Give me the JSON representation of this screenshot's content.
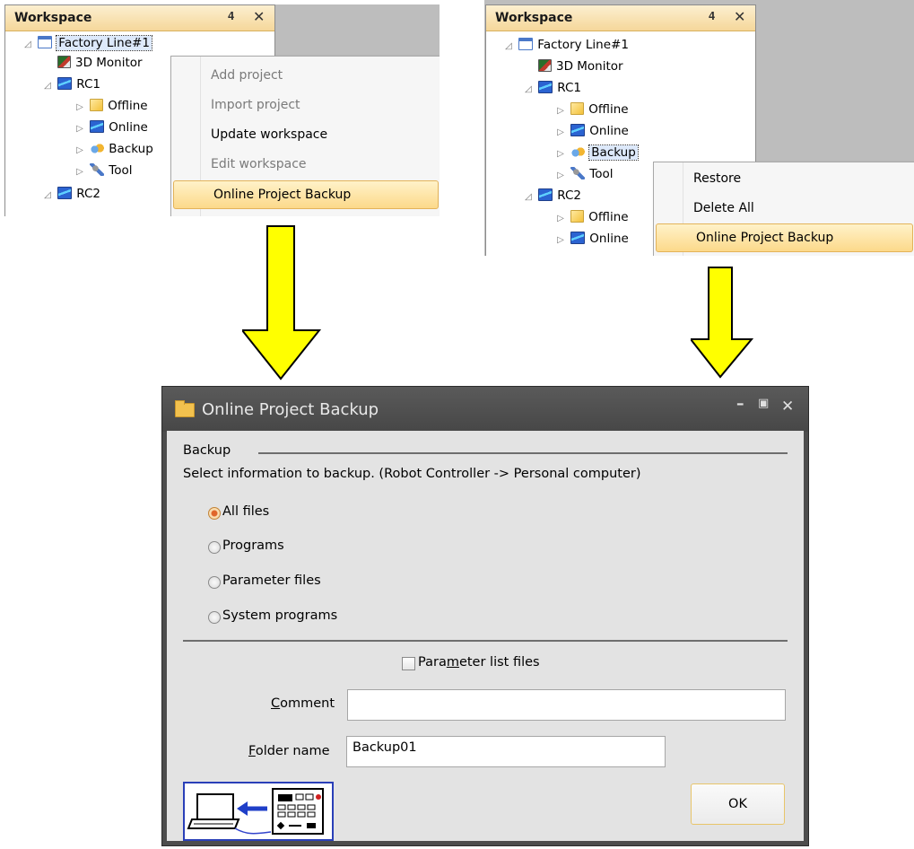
{
  "left_panel": {
    "title": "Workspace",
    "pin": "ɹ",
    "close": "✕",
    "tree": [
      {
        "label": "Factory Line#1",
        "icon": "workspace-icon",
        "selected": true
      },
      {
        "label": "3D Monitor",
        "icon": "3d-monitor-icon"
      },
      {
        "label": "RC1",
        "icon": "robot-controller-icon"
      },
      {
        "label": "Offline",
        "icon": "offline-icon"
      },
      {
        "label": "Online",
        "icon": "online-icon"
      },
      {
        "label": "Backup",
        "icon": "backup-icon"
      },
      {
        "label": "Tool",
        "icon": "tool-icon"
      },
      {
        "label": "RC2",
        "icon": "robot-controller-icon"
      }
    ],
    "menu": [
      {
        "label": "Add project",
        "enabled": false
      },
      {
        "label": "Import project",
        "enabled": false
      },
      {
        "label": "Update workspace",
        "enabled": true
      },
      {
        "label": "Edit workspace",
        "enabled": false
      },
      {
        "label": "Online Project Backup",
        "enabled": true,
        "highlighted": true
      }
    ]
  },
  "right_panel": {
    "title": "Workspace",
    "tree": [
      {
        "label": "Factory Line#1",
        "icon": "workspace-icon"
      },
      {
        "label": "3D Monitor",
        "icon": "3d-monitor-icon"
      },
      {
        "label": "RC1",
        "icon": "robot-controller-icon"
      },
      {
        "label": "Offline",
        "icon": "offline-icon"
      },
      {
        "label": "Online",
        "icon": "online-icon"
      },
      {
        "label": "Backup",
        "icon": "backup-icon",
        "selected": true
      },
      {
        "label": "Tool",
        "icon": "tool-icon"
      },
      {
        "label": "RC2",
        "icon": "robot-controller-icon"
      },
      {
        "label": "Offline",
        "icon": "offline-icon"
      },
      {
        "label": "Online",
        "icon": "online-icon"
      }
    ],
    "menu": [
      {
        "label": "Restore",
        "enabled": true
      },
      {
        "label": "Delete All",
        "enabled": true
      },
      {
        "label": "Online Project Backup",
        "enabled": true,
        "highlighted": true
      }
    ]
  },
  "arrow_color": "#ffff00",
  "dialog": {
    "title": "Online Project Backup",
    "minimize": "—",
    "maximize": "□",
    "close": "✕",
    "group_label": "Backup",
    "instruction": "Select information to backup. (Robot Controller -> Personal computer)",
    "options": [
      {
        "label": "All files",
        "checked": true
      },
      {
        "label": "Programs",
        "checked": false
      },
      {
        "label": "Parameter files",
        "checked": false
      },
      {
        "label": "System programs",
        "checked": false
      }
    ],
    "param_list": {
      "pre": "Para",
      "mnemonic": "m",
      "post": "eter list files",
      "checked": false
    },
    "comment": {
      "mnemonic": "C",
      "rest": "omment",
      "value": ""
    },
    "folder": {
      "mnemonic": "F",
      "rest": "older name",
      "value": "Backup01"
    },
    "ok_label": "OK"
  }
}
